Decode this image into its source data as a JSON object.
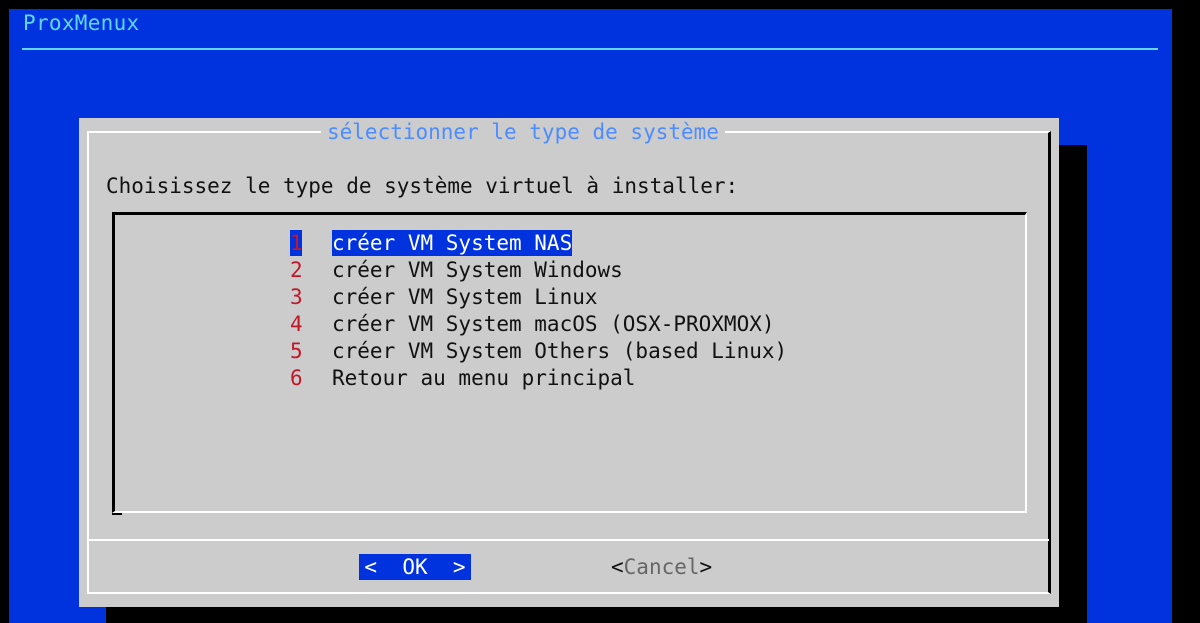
{
  "backtitle": "ProxMenux",
  "dialog": {
    "title": "sélectionner le type de système",
    "prompt": "Choisissez le type de système virtuel à installer:",
    "items": [
      {
        "tag": "1",
        "label": "créer VM System NAS"
      },
      {
        "tag": "2",
        "label": "créer VM System Windows"
      },
      {
        "tag": "3",
        "label": "créer VM System Linux"
      },
      {
        "tag": "4",
        "label": "créer VM System macOS (OSX-PROXMOX)"
      },
      {
        "tag": "5",
        "label": "créer VM System Others (based Linux)"
      },
      {
        "tag": "6",
        "label": "Retour au menu principal"
      }
    ],
    "selected_index": 0,
    "ok_label": "<  OK  >",
    "cancel_left": "<",
    "cancel_text": "Cancel",
    "cancel_right": ">"
  },
  "colors": {
    "background": "#0033dd",
    "dialog_bg": "#cccccc",
    "tag": "#c0182a",
    "title": "#4d8cff"
  }
}
